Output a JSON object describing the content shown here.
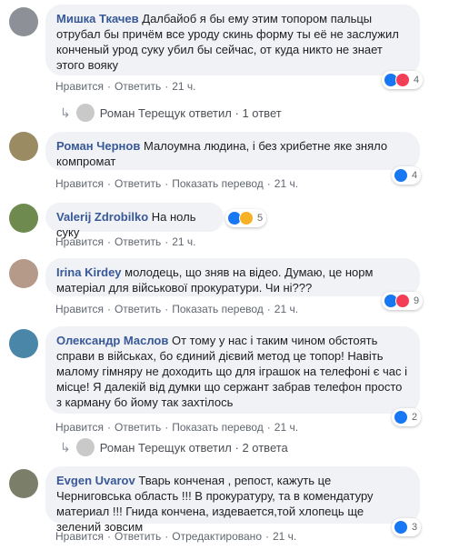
{
  "comments": [
    {
      "author": "Мишка Ткачев",
      "text": "Далбайоб я бы ему этим топором пальцы отрубал бы причём все уроду скинь форму ты её не заслужил конченый урод суку убил бы сейчас, от куда никто не знает этого вояку",
      "like": "Нравится",
      "reply": "Ответить",
      "time": "21 ч.",
      "reactions": "4",
      "reaction_icons": [
        "like-icon",
        "love-icon"
      ],
      "avatar_color": "#8d9096"
    },
    {
      "author": "Роман Чернов",
      "text": "Малоумна людина, і без хрибетне яке зняло компромат",
      "like": "Нравится",
      "reply": "Ответить",
      "translate": "Показать перевод",
      "time": "21 ч.",
      "reactions": "4",
      "reaction_icons": [
        "like-icon"
      ],
      "avatar_color": "#9b8b63"
    },
    {
      "author": "Valerij Zdrobilko",
      "text": "На ноль суку",
      "like": "Нравится",
      "reply": "Ответить",
      "time": "21 ч.",
      "reactions": "5",
      "reaction_icons": [
        "like-icon",
        "sad-icon"
      ],
      "avatar_color": "#6f8a4e"
    },
    {
      "author": "Irina Kirdey",
      "text": "молодець, що зняв на відео. Думаю, це норм матеріал для військової прокуратури. Чи ні???",
      "like": "Нравится",
      "reply": "Ответить",
      "translate": "Показать перевод",
      "time": "21 ч.",
      "reactions": "9",
      "reaction_icons": [
        "like-icon",
        "love-icon"
      ],
      "avatar_color": "#b59a8a"
    },
    {
      "author": "Олександр Маслов",
      "text": "От тому у нас і таким чином обстоять справи в військах, бо єдиний дієвий метод це топор! Навіть малому гімняру не доходить що для іграшок на телефоні є час і місце! Я далекій від думки що сержант забрав телефон просто з карману бо йому так захтілось",
      "like": "Нравится",
      "reply": "Ответить",
      "translate": "Показать перевод",
      "time": "21 ч.",
      "reactions": "2",
      "reaction_icons": [
        "like-icon"
      ],
      "avatar_color": "#4a86a8"
    },
    {
      "author": "Evgen Uvarov",
      "text": "Тварь конченая , репост, кажуть це Черниговська область !!! В прокуратуру, та в комендатуру материал !!! Гнида конченa, издевается,той хлопець ще зелений зовсим",
      "like": "Нравится",
      "reply": "Ответить",
      "translate": "Отредактировано",
      "time": "21 ч.",
      "reactions": "3",
      "reaction_icons": [
        "like-icon"
      ],
      "avatar_color": "#7b7f6a"
    }
  ],
  "reply_threads": [
    {
      "name": "Роман Терещук",
      "verb": "ответил",
      "sep": "·",
      "count": "1 ответ"
    },
    {
      "name": "Роман Терещук",
      "verb": "ответил",
      "sep": "·",
      "count": "2 ответа"
    }
  ],
  "separator": "·",
  "colors": {
    "link": "#385898",
    "bubble": "#f0f2f5",
    "like": "#1877f2"
  }
}
